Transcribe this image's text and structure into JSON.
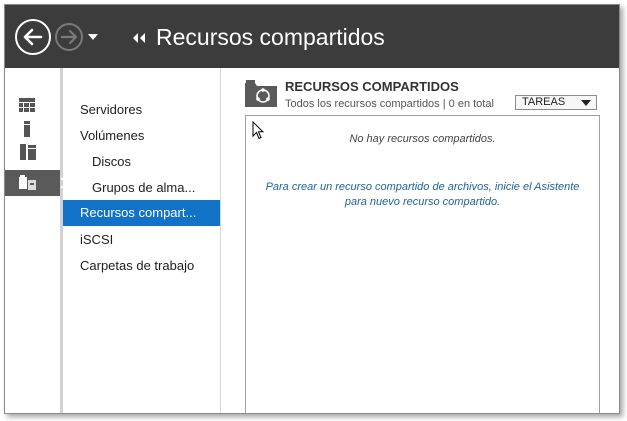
{
  "header": {
    "title": "Recursos compartidos",
    "back_icon": "back-arrow-icon",
    "forward_icon": "forward-arrow-icon",
    "history_icon": "dropdown-arrow-icon"
  },
  "iconbar": {
    "items": [
      {
        "icon": "dashboard-icon"
      },
      {
        "icon": "local-server-icon"
      },
      {
        "icon": "all-servers-icon"
      },
      {
        "icon": "file-storage-icon",
        "active": true
      }
    ]
  },
  "nav": {
    "items": [
      {
        "label": "Servidores",
        "level": 1
      },
      {
        "label": "Volúmenes",
        "level": 1
      },
      {
        "label": "Discos",
        "level": 2
      },
      {
        "label": "Grupos de alma...",
        "level": 2
      },
      {
        "label": "Recursos compart...",
        "level": 1,
        "selected": true
      },
      {
        "label": "iSCSI",
        "level": 1
      },
      {
        "label": "Carpetas de trabajo",
        "level": 1
      }
    ]
  },
  "content": {
    "section_title": "RECURSOS COMPARTIDOS",
    "section_subtitle": "Todos los recursos compartidos | 0 en total",
    "tasks_label": "TAREAS",
    "empty_message": "No hay recursos compartidos.",
    "help_text": "Para crear un recurso compartido de archivos, inicie el Asistente para nuevo recurso compartido."
  },
  "colors": {
    "titlebar": "#3c3c3c",
    "selection": "#1273c6",
    "link": "#1e6496"
  }
}
